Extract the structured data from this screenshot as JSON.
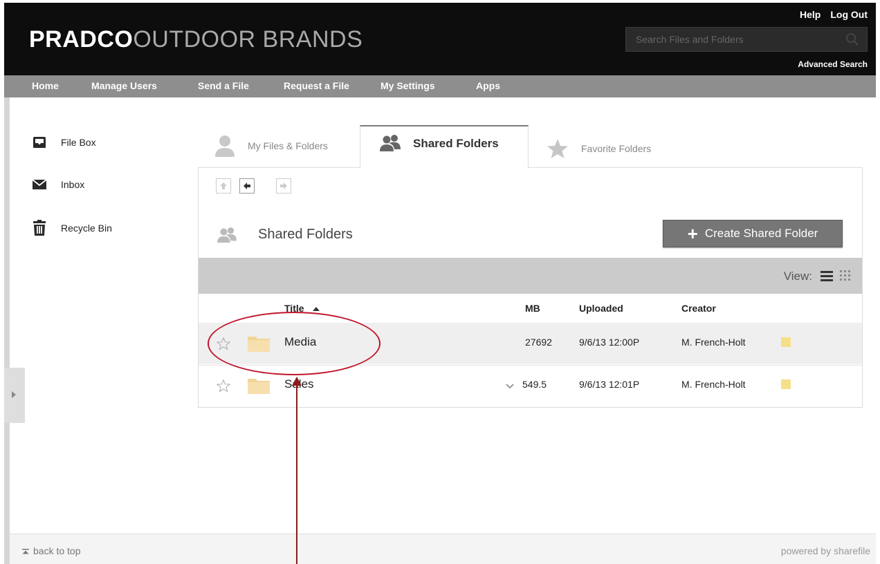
{
  "header": {
    "logo_bold": "PRADCO",
    "logo_thin": "OUTDOOR BRANDS",
    "help": "Help",
    "logout": "Log Out",
    "search_placeholder": "Search Files and Folders",
    "advanced_search": "Advanced Search"
  },
  "nav": {
    "items": [
      "Home",
      "Manage Users",
      "Send a File",
      "Request a File",
      "My Settings",
      "Apps"
    ]
  },
  "sidebar": {
    "items": [
      {
        "label": "File Box",
        "icon": "tray-icon"
      },
      {
        "label": "Inbox",
        "icon": "envelope-icon"
      },
      {
        "label": "Recycle Bin",
        "icon": "trash-icon"
      }
    ]
  },
  "tabs": [
    {
      "label": "My Files & Folders",
      "icon": "person-icon"
    },
    {
      "label": "Shared Folders",
      "icon": "people-icon",
      "active": true
    },
    {
      "label": "Favorite Folders",
      "icon": "star-icon"
    }
  ],
  "panel": {
    "title": "Shared Folders",
    "create_button": "Create Shared Folder",
    "view_label": "View:",
    "columns": {
      "title": "Title",
      "mb": "MB",
      "uploaded": "Uploaded",
      "creator": "Creator"
    },
    "rows": [
      {
        "title": "Media",
        "mb": "27692",
        "uploaded": "9/6/13 12:00P",
        "creator": "M. French-Holt"
      },
      {
        "title": "Sales",
        "mb": "549.5",
        "uploaded": "9/6/13 12:01P",
        "creator": "M. French-Holt"
      }
    ]
  },
  "footer": {
    "back_to_top": "back to top",
    "powered_by": "powered by sharefile"
  },
  "colors": {
    "header_bg": "#0d0d0d",
    "nav_bg": "#8e8e8e",
    "annotation": "#c0162c",
    "folder": "#f1d49a"
  }
}
